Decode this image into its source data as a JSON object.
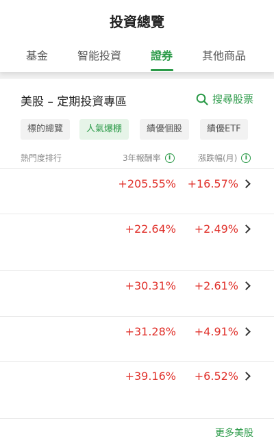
{
  "header": {
    "title": "投資總覽",
    "tabs": [
      {
        "label": "基金"
      },
      {
        "label": "智能投資"
      },
      {
        "label": "證券"
      },
      {
        "label": "其他商品"
      }
    ],
    "active_tab": "證券"
  },
  "section": {
    "title": "美股 – 定期投資專區",
    "search_label": "搜尋股票"
  },
  "chips": [
    {
      "label": "標的總覽"
    },
    {
      "label": "人氣爆棚"
    },
    {
      "label": "績優個股"
    },
    {
      "label": "績優ETF"
    }
  ],
  "active_chip": "人氣爆棚",
  "columns": {
    "rank": "熱門度排行",
    "return_3y": "3年報酬率",
    "change_month": "漲跌幅(月)"
  },
  "rows": [
    {
      "return_3y": "+205.55%",
      "change_month": "+16.57%"
    },
    {
      "return_3y": "+22.64%",
      "change_month": "+2.49%"
    },
    {
      "return_3y": "+30.31%",
      "change_month": "+2.61%"
    },
    {
      "return_3y": "+31.28%",
      "change_month": "+4.91%"
    },
    {
      "return_3y": "+39.16%",
      "change_month": "+6.52%"
    }
  ],
  "more_label": "更多美股",
  "colors": {
    "accent": "#2b9a48",
    "positive": "#e0302a"
  }
}
